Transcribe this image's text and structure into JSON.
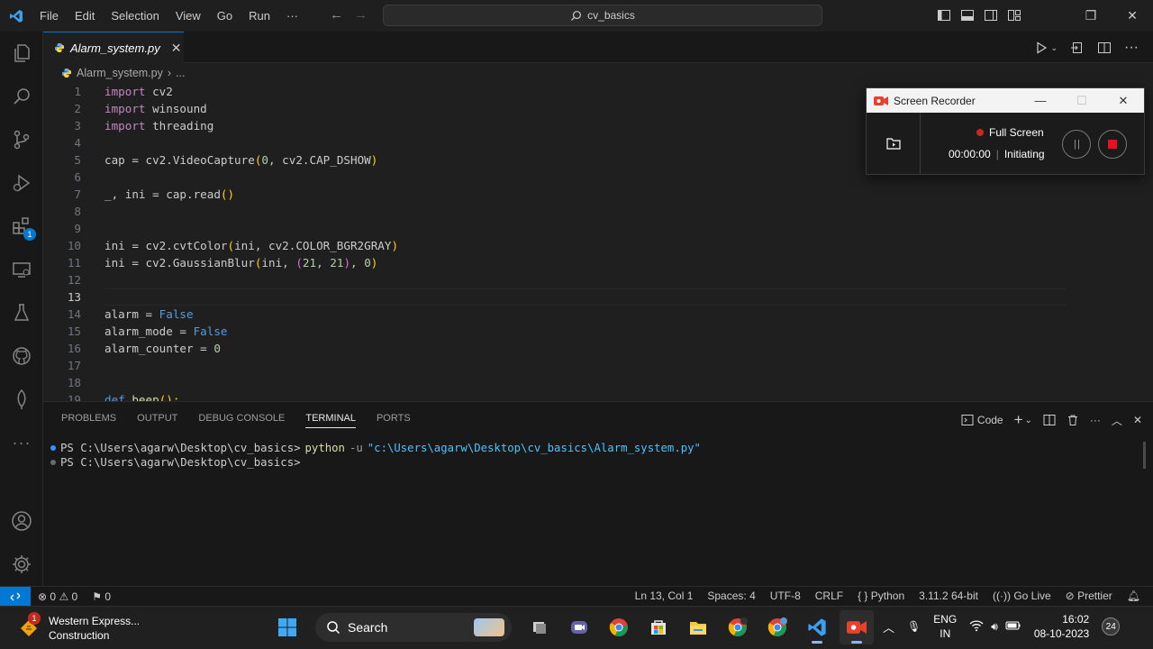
{
  "titlebar": {
    "menu": [
      "File",
      "Edit",
      "Selection",
      "View",
      "Go",
      "Run",
      "···"
    ],
    "search_text": "cv_basics"
  },
  "editor": {
    "tab_label": "Alarm_system.py",
    "breadcrumb_file": "Alarm_system.py",
    "breadcrumb_more": "...",
    "line_numbers": [
      "1",
      "2",
      "3",
      "4",
      "5",
      "6",
      "7",
      "8",
      "9",
      "10",
      "11",
      "12",
      "13",
      "14",
      "15",
      "16",
      "17",
      "18",
      "19"
    ],
    "lines": [
      [
        {
          "t": "import",
          "c": "kwp"
        },
        {
          "t": " cv2",
          "c": ""
        }
      ],
      [
        {
          "t": "import",
          "c": "kwp"
        },
        {
          "t": " winsound",
          "c": ""
        }
      ],
      [
        {
          "t": "import",
          "c": "kwp"
        },
        {
          "t": " threading",
          "c": ""
        }
      ],
      [],
      [
        {
          "t": "cap = cv2.VideoCapture",
          "c": ""
        },
        {
          "t": "(",
          "c": "br"
        },
        {
          "t": "0",
          "c": "num"
        },
        {
          "t": ", cv2.CAP_DSHOW",
          "c": ""
        },
        {
          "t": ")",
          "c": "br"
        }
      ],
      [],
      [
        {
          "t": "_, ini = cap.read",
          "c": ""
        },
        {
          "t": "()",
          "c": "br"
        }
      ],
      [],
      [],
      [
        {
          "t": "ini = cv2.cvtColor",
          "c": ""
        },
        {
          "t": "(",
          "c": "br"
        },
        {
          "t": "ini, cv2.COLOR_BGR2GRAY",
          "c": ""
        },
        {
          "t": ")",
          "c": "br"
        }
      ],
      [
        {
          "t": "ini = cv2.GaussianBlur",
          "c": ""
        },
        {
          "t": "(",
          "c": "br"
        },
        {
          "t": "ini, ",
          "c": ""
        },
        {
          "t": "(",
          "c": "br2"
        },
        {
          "t": "21",
          "c": "num"
        },
        {
          "t": ", ",
          "c": ""
        },
        {
          "t": "21",
          "c": "num"
        },
        {
          "t": ")",
          "c": "br2"
        },
        {
          "t": ", ",
          "c": ""
        },
        {
          "t": "0",
          "c": "num"
        },
        {
          "t": ")",
          "c": "br"
        }
      ],
      [],
      [],
      [
        {
          "t": "alarm = ",
          "c": ""
        },
        {
          "t": "False",
          "c": "kw"
        }
      ],
      [
        {
          "t": "alarm_mode = ",
          "c": ""
        },
        {
          "t": "False",
          "c": "kw"
        }
      ],
      [
        {
          "t": "alarm_counter = ",
          "c": ""
        },
        {
          "t": "0",
          "c": "num"
        }
      ],
      [],
      [],
      [
        {
          "t": "def",
          "c": "kw"
        },
        {
          "t": " ",
          "c": ""
        },
        {
          "t": "beep",
          "c": "fn"
        },
        {
          "t": "():",
          "c": "br"
        }
      ]
    ]
  },
  "panel": {
    "tabs": [
      "PROBLEMS",
      "OUTPUT",
      "DEBUG CONSOLE",
      "TERMINAL",
      "PORTS"
    ],
    "active_tab": "TERMINAL",
    "terminal_profile": "Code",
    "terminal": {
      "prompt": "PS C:\\Users\\agarw\\Desktop\\cv_basics>",
      "cmd": "python",
      "flag": "-u",
      "arg": "\"c:\\Users\\agarw\\Desktop\\cv_basics\\Alarm_system.py\""
    }
  },
  "statusbar": {
    "errors": "0",
    "warnings": "0",
    "ports": "0",
    "position": "Ln 13, Col 1",
    "spaces": "Spaces: 4",
    "encoding": "UTF-8",
    "eol": "CRLF",
    "language": "Python",
    "interpreter": "3.11.2 64-bit",
    "golive": "Go Live",
    "prettier": "Prettier"
  },
  "recorder": {
    "title": "Screen Recorder",
    "mode": "Full Screen",
    "time": "00:00:00",
    "status": "Initiating"
  },
  "taskbar": {
    "weather_title": "Western Express...",
    "weather_sub": "Construction",
    "weather_badge": "1",
    "search": "Search",
    "lang1": "ENG",
    "lang2": "IN",
    "time": "16:02",
    "date": "08-10-2023",
    "notif": "24"
  },
  "activity": {
    "extensions_badge": "1"
  },
  "colors": {
    "accent": "#0078d4",
    "record": "#e81123"
  }
}
